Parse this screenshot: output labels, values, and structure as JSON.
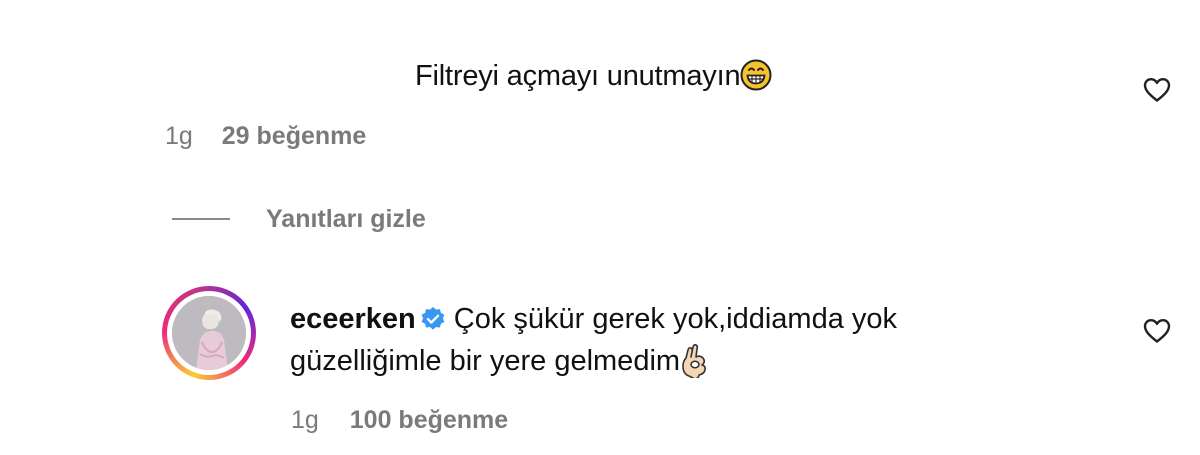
{
  "top_comment": {
    "text": "Filtreyi açmayı unutmayın",
    "emoji": "grinning-face-icon",
    "time": "1g",
    "likes": "29 beğenme"
  },
  "replies_toggle": {
    "label": "Yanıtları gizle"
  },
  "reply": {
    "username": "eceerken",
    "verified": true,
    "text": "Çok şükür gerek yok,iddiamda yok güzelliğimle bir yere gelmedim",
    "emoji": "ok-hand-icon",
    "time": "1g",
    "likes": "100 beğenme"
  },
  "colors": {
    "meta_gray": "#7a7a7a",
    "verified_blue": "#3897f0",
    "story_ring": [
      "#f9ce34",
      "#ee2a7b",
      "#6228d7"
    ]
  }
}
